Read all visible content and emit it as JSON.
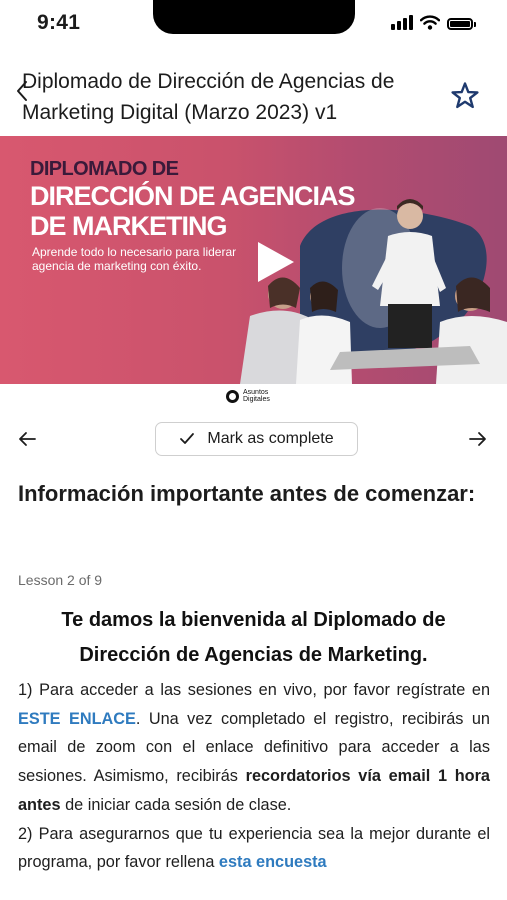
{
  "status_bar": {
    "time": "9:41"
  },
  "header": {
    "title": "Diplomado de Dirección de Agencias de Marketing Digital (Marzo 2023) v1"
  },
  "hero": {
    "line1": "DIPLOMADO DE",
    "line2": "DIRECCIÓN DE AGENCIAS",
    "line3": "DE MARKETING",
    "subtitle": "Aprende todo lo necesario para liderar agencia de marketing con éxito."
  },
  "brand": {
    "name": "Asuntos Digitales"
  },
  "lesson_nav": {
    "complete_label": "Mark as complete"
  },
  "lesson": {
    "title": "Información importante antes de comenzar:",
    "counter": "Lesson 2 of 9",
    "welcome": "Te damos la bienvenida al Diplomado de Dirección de Agencias de Marketing.",
    "p1_a": "1) Para acceder a las sesiones en vivo, por favor regístrate en ",
    "p1_link": "ESTE ENLACE",
    "p1_b": ". Una vez completado el registro, recibirás un email de zoom con el enlace definitivo para acceder a las sesiones. Asimismo, recibirás ",
    "p1_bold": "recordatorios vía email 1 hora antes",
    "p1_c": " de iniciar cada sesión de clase.",
    "p2_a": "2) Para asegurarnos que tu experiencia sea la mejor durante el programa, por favor rellena ",
    "p2_link": "esta encuesta"
  },
  "colors": {
    "accent": "#2f7bbf",
    "star": "#1f3a6e",
    "hero_left": "#d8586f",
    "hero_right": "#9f4a72",
    "hero_shape": "#2f3f63"
  }
}
